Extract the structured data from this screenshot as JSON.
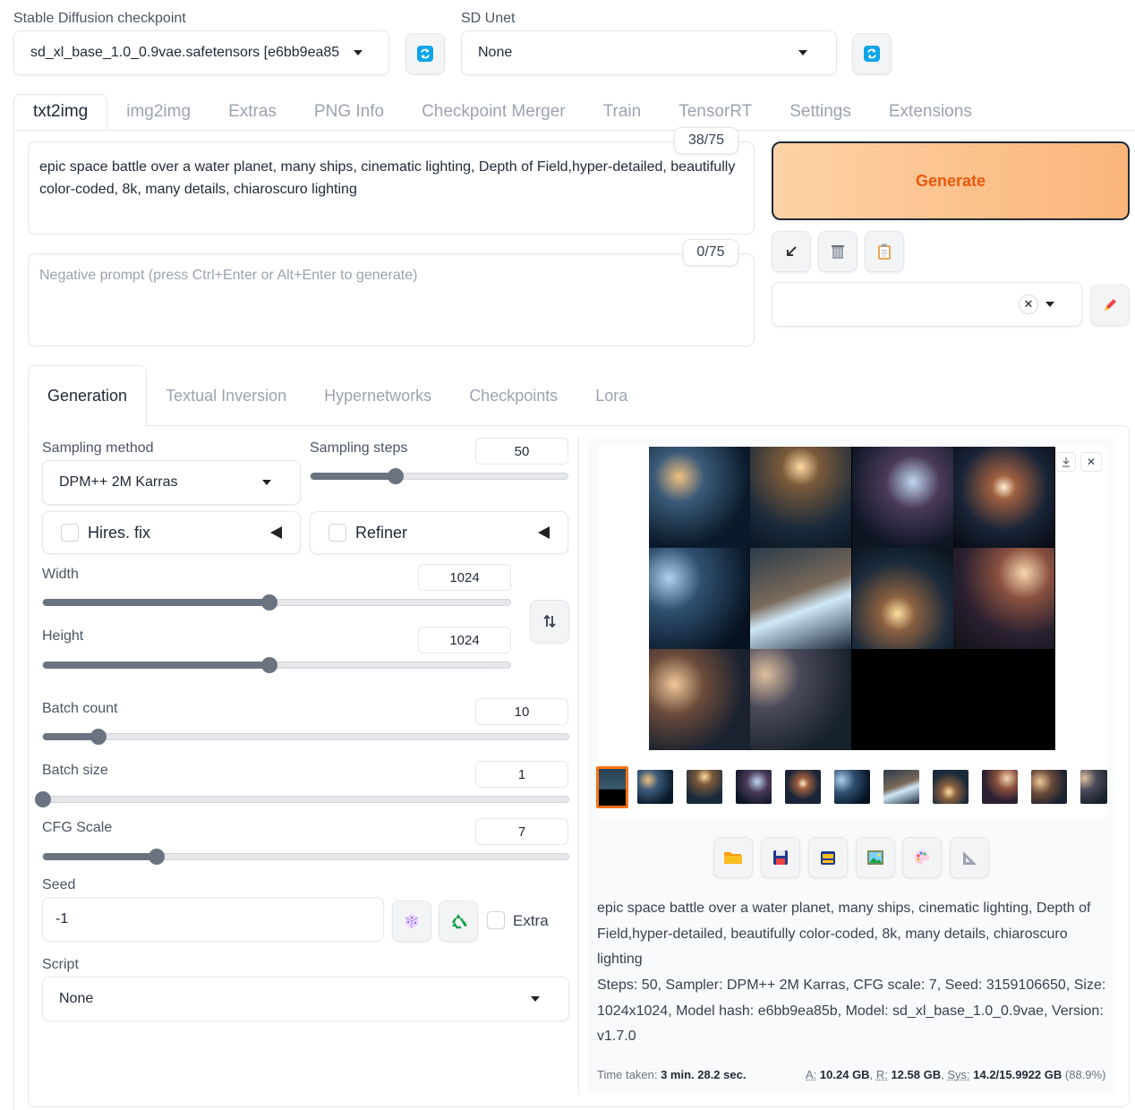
{
  "top": {
    "checkpoint_label": "Stable Diffusion checkpoint",
    "checkpoint_value": "sd_xl_base_1.0_0.9vae.safetensors [e6bb9ea85",
    "unet_label": "SD Unet",
    "unet_value": "None"
  },
  "main_tabs": [
    "txt2img",
    "img2img",
    "Extras",
    "PNG Info",
    "Checkpoint Merger",
    "Train",
    "TensorRT",
    "Settings",
    "Extensions"
  ],
  "prompt": {
    "text": "epic space battle over a water planet, many ships, cinematic lighting, Depth of Field,hyper-detailed, beautifully color-coded, 8k, many details, chiaroscuro lighting",
    "counter": "38/75"
  },
  "negative_prompt": {
    "placeholder": "Negative prompt (press Ctrl+Enter or Alt+Enter to generate)",
    "counter": "0/75"
  },
  "generate_label": "Generate",
  "sub_tabs": [
    "Generation",
    "Textual Inversion",
    "Hypernetworks",
    "Checkpoints",
    "Lora"
  ],
  "settings": {
    "sampling_method_label": "Sampling method",
    "sampling_method_value": "DPM++ 2M Karras",
    "sampling_steps_label": "Sampling steps",
    "sampling_steps_value": "50",
    "hires_label": "Hires. fix",
    "refiner_label": "Refiner",
    "width_label": "Width",
    "width_value": "1024",
    "height_label": "Height",
    "height_value": "1024",
    "batch_count_label": "Batch count",
    "batch_count_value": "10",
    "batch_size_label": "Batch size",
    "batch_size_value": "1",
    "cfg_label": "CFG Scale",
    "cfg_value": "7",
    "seed_label": "Seed",
    "seed_value": "-1",
    "extra_label": "Extra",
    "script_label": "Script",
    "script_value": "None"
  },
  "slider_levels": {
    "sampling_steps": 0.33,
    "width": 0.485,
    "height": 0.485,
    "batch_count": 0.105,
    "batch_size": 0.0,
    "cfg": 0.217
  },
  "output": {
    "info_prompt": "epic space battle over a water planet, many ships, cinematic lighting, Depth of Field,hyper-detailed, beautifully color-coded, 8k, many details, chiaroscuro lighting",
    "info_params": "Steps: 50, Sampler: DPM++ 2M Karras, CFG scale: 7, Seed: 3159106650, Size: 1024x1024, Model hash: e6bb9ea85b, Model: sd_xl_base_1.0_0.9vae, Version: v1.7.0",
    "time_label": "Time taken:",
    "time_value": "3 min. 28.2 sec.",
    "vram_a_label": "A:",
    "vram_a_value": "10.24 GB",
    "vram_r_label": "R:",
    "vram_r_value": "12.58 GB",
    "vram_sys_label": "Sys:",
    "vram_sys_value": "14.2/15.9922 GB",
    "vram_pct": "(88.9%)"
  },
  "colors": {
    "generate_start": "#fdd2a6",
    "generate_end": "#fbb57a",
    "generate_text": "#ea580c",
    "accent_blue": "#0ea5e9",
    "selected_thumb": "#f97316"
  }
}
